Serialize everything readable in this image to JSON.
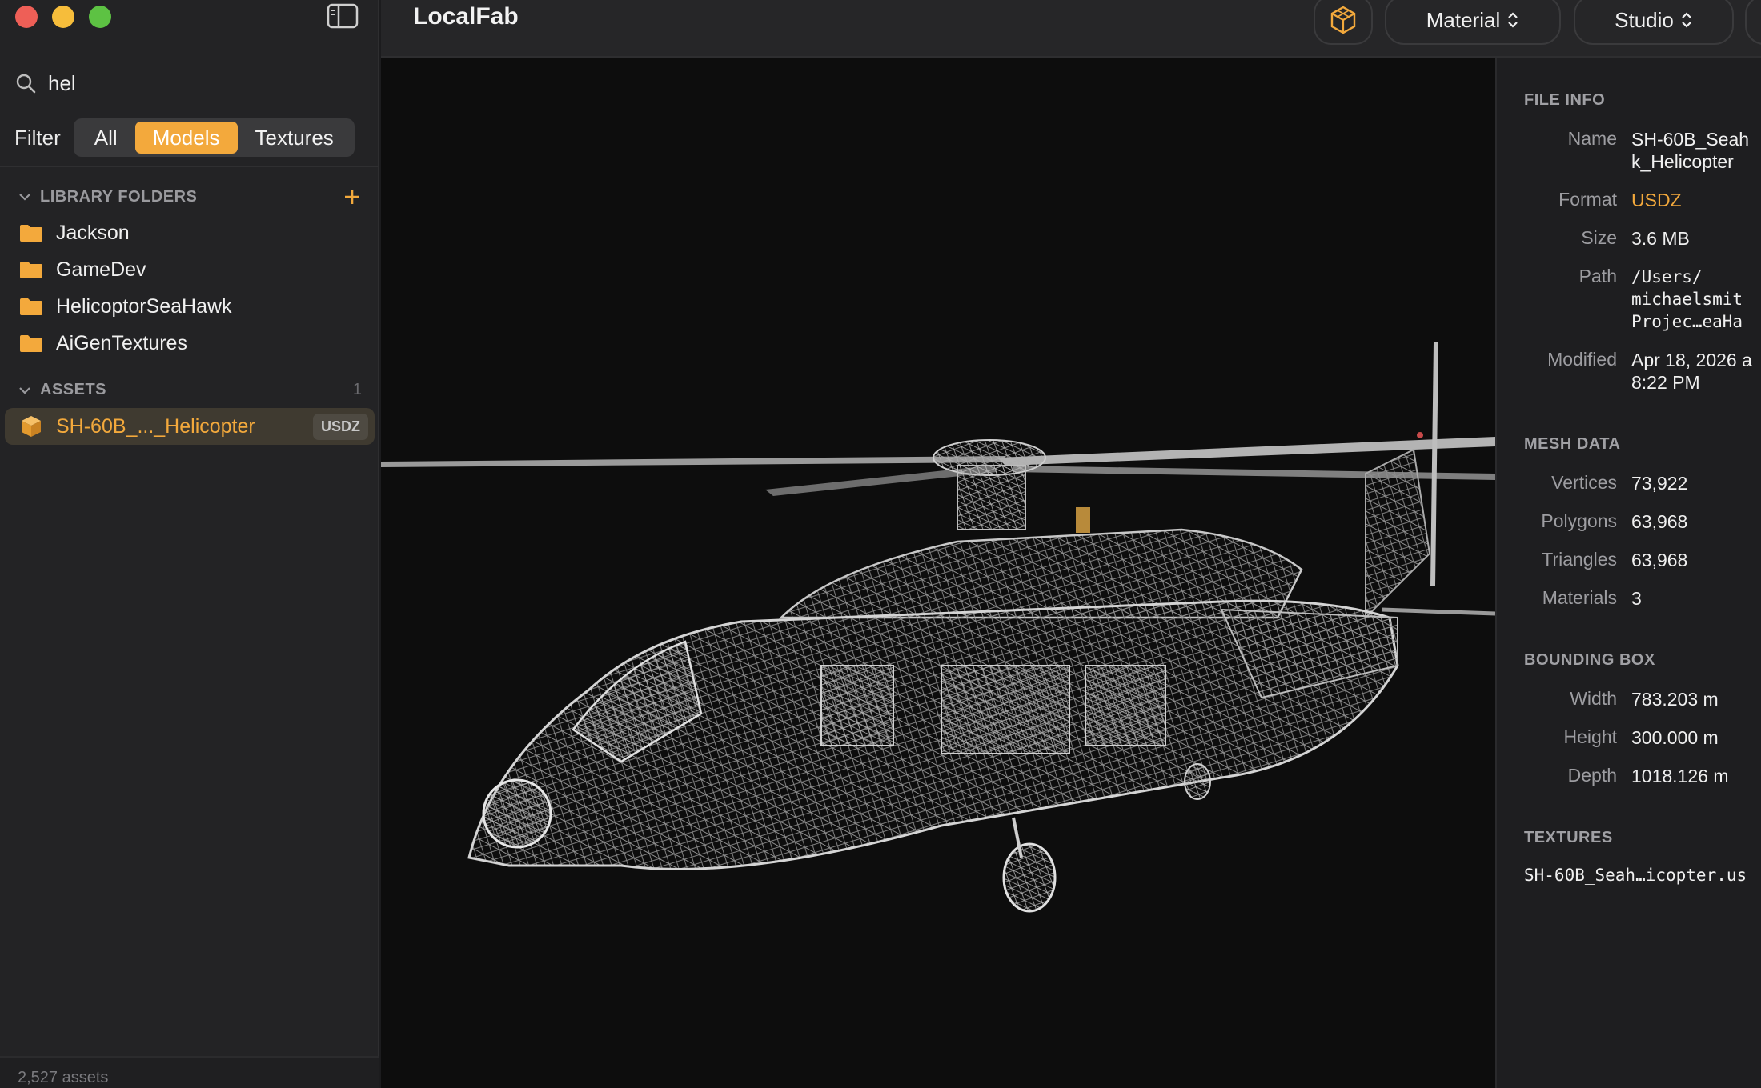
{
  "sidebar": {
    "search_value": "hel",
    "filter_label": "Filter",
    "filters": [
      "All",
      "Models",
      "Textures"
    ],
    "active_filter": "Models",
    "library_header": "LIBRARY FOLDERS",
    "folders": [
      "Jackson",
      "GameDev",
      "HelicoptorSeaHawk",
      "AiGenTextures"
    ],
    "assets_header": "ASSETS",
    "assets_count": "1",
    "assets": [
      {
        "name": "SH-60B_..._Helicopter",
        "badge": "USDZ"
      }
    ],
    "footer": "2,527 assets"
  },
  "toolbar": {
    "title": "LocalFab",
    "material_label": "Material",
    "studio_label": "Studio"
  },
  "inspector": {
    "file_info_header": "FILE INFO",
    "name_label": "Name",
    "name_value": "SH-60B_Seah\nk_Helicopter",
    "format_label": "Format",
    "format_value": "USDZ",
    "size_label": "Size",
    "size_value": "3.6 MB",
    "path_label": "Path",
    "path_value": "/Users/\nmichaelsmit\nProjec…eaHa",
    "modified_label": "Modified",
    "modified_value": "Apr 18, 2026 a\n8:22 PM",
    "mesh_header": "MESH DATA",
    "vertices_label": "Vertices",
    "vertices_value": "73,922",
    "polygons_label": "Polygons",
    "polygons_value": "63,968",
    "triangles_label": "Triangles",
    "triangles_value": "63,968",
    "materials_label": "Materials",
    "materials_value": "3",
    "bbox_header": "BOUNDING BOX",
    "width_label": "Width",
    "width_value": "783.203 m",
    "height_label": "Height",
    "height_value": "300.000 m",
    "depth_label": "Depth",
    "depth_value": "1018.126 m",
    "textures_header": "TEXTURES",
    "texture_file": "SH-60B_Seah…icopter.us"
  },
  "colors": {
    "accent": "#f3a93c",
    "sidebar_bg": "#232325",
    "viewport_bg": "#0d0d0d"
  }
}
